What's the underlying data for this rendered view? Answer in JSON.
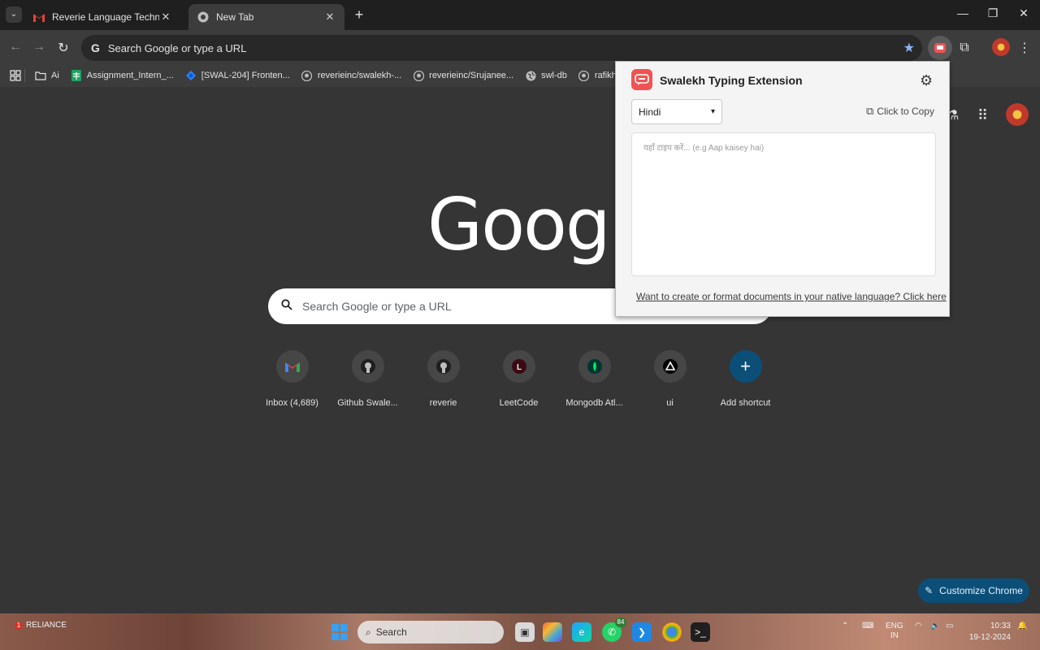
{
  "browser": {
    "tabs": [
      {
        "title": "Reverie Language Technologies",
        "icon": "gmail-icon"
      },
      {
        "title": "New Tab",
        "icon": "chrome-icon"
      }
    ],
    "omnibox_placeholder": "Search Google or type a URL",
    "bookmarks": [
      {
        "label": "Ai",
        "icon": "folder-icon"
      },
      {
        "label": "Assignment_Intern_...",
        "icon": "sheets-icon"
      },
      {
        "label": "[SWAL-204] Fronten...",
        "icon": "jira-icon"
      },
      {
        "label": "reverieinc/swalekh-...",
        "icon": "github-icon"
      },
      {
        "label": "reverieinc/Srujanee...",
        "icon": "github-icon"
      },
      {
        "label": "swl-db",
        "icon": "globe-icon"
      },
      {
        "label": "rafikhanreverie",
        "icon": "github-icon"
      }
    ]
  },
  "ntp": {
    "logo_text": "Google",
    "search_placeholder": "Search Google or type a URL",
    "shortcuts": [
      {
        "label": "Inbox (4,689)",
        "glyph": "M",
        "icon": "gmail-icon"
      },
      {
        "label": "Github Swale...",
        "glyph": "●",
        "icon": "github-icon"
      },
      {
        "label": "reverie",
        "glyph": "●",
        "icon": "github-icon"
      },
      {
        "label": "LeetCode",
        "glyph": "L",
        "icon": "leetcode-icon"
      },
      {
        "label": "Mongodb Atl...",
        "glyph": "◆",
        "icon": "mongodb-icon"
      },
      {
        "label": "ui",
        "glyph": "▲",
        "icon": "ui-icon"
      },
      {
        "label": "Add shortcut",
        "glyph": "+",
        "icon": "plus-icon"
      }
    ],
    "customize_label": "Customize Chrome"
  },
  "extension_popup": {
    "title": "Swalekh Typing Extension",
    "language_selected": "Hindi",
    "copy_label": "Click to Copy",
    "textarea_placeholder": "यहाँ टाइप करें... (e.g Aap kaisey hai)",
    "footer_link": "Want to create or format documents in your native language? Click here",
    "brand_color": "#f05353"
  },
  "taskbar": {
    "weather_badge": "1",
    "weather_text": "RELIANCE",
    "search_placeholder": "Search",
    "whatsapp_badge": "84",
    "lang_line1": "ENG",
    "lang_line2": "IN",
    "time": "10:33",
    "date": "19-12-2024"
  }
}
